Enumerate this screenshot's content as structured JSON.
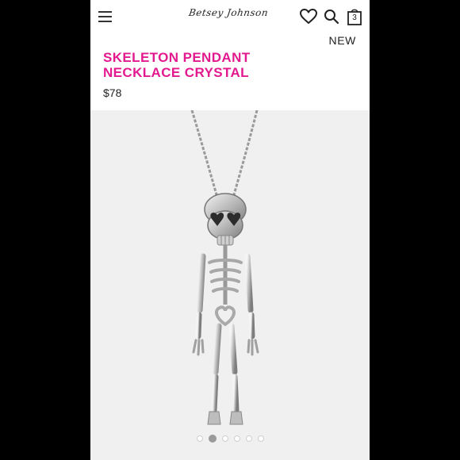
{
  "header": {
    "brand": "Betsey Johnson",
    "bag_count": "3"
  },
  "product": {
    "badge": "NEW",
    "title_line1": "SKELETON PENDANT",
    "title_line2": "NECKLACE CRYSTAL",
    "price": "$78"
  },
  "gallery": {
    "dot_count": 6,
    "active_index": 1
  },
  "colors": {
    "brand_pink": "#e3198f",
    "image_background": "#f0f0f0"
  },
  "icons": [
    "hamburger-menu-icon",
    "heart-icon",
    "search-icon",
    "shopping-bag-icon"
  ]
}
